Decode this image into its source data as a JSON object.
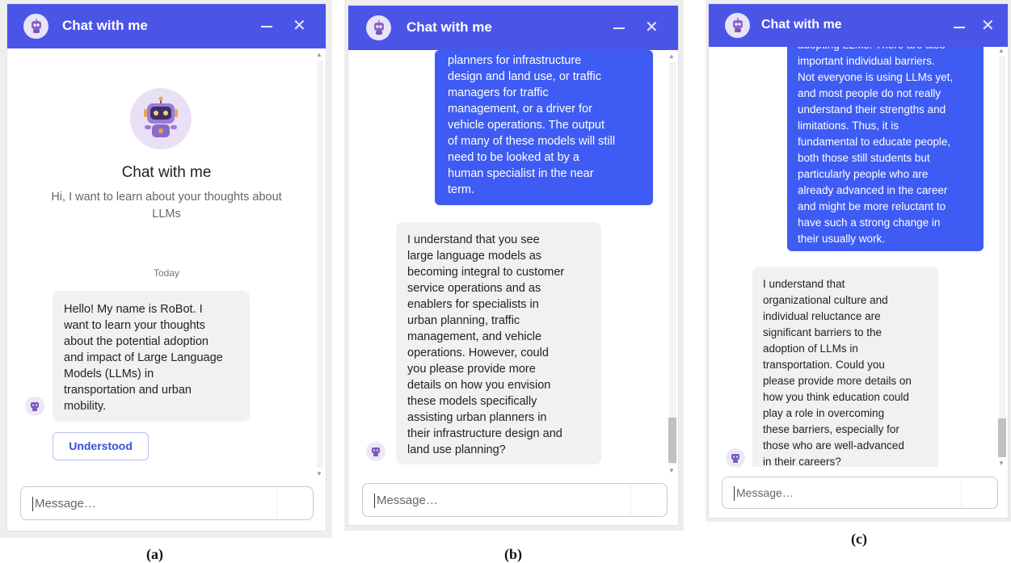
{
  "header": {
    "title": "Chat with me",
    "minimize_icon": "minimize-icon",
    "close_icon": "close-icon",
    "close_glyph": "✕"
  },
  "panel_a": {
    "welcome_title": "Chat with me",
    "welcome_subtitle_lines": [
      "Hi, I want to learn about your thoughts about",
      "LLMs"
    ],
    "date_divider": "Today",
    "bot_message_lines": [
      "Hello! My name is RoBot. I",
      "want to learn your thoughts",
      "about the potential adoption",
      "and impact of Large Language",
      "Models (LLMs) in",
      "transportation and urban",
      "mobility."
    ],
    "quick_reply": "Understood",
    "input_placeholder": "Message…"
  },
  "panel_b": {
    "user_message_lines": [
      "planners for infrastructure",
      "design and land use, or traffic",
      "managers for traffic",
      "management, or a driver for",
      "vehicle operations. The output",
      "of many of these models will still",
      "need to be looked at by a",
      "human specialist in the near",
      "term."
    ],
    "bot_message_lines": [
      "I understand that you see",
      "large language models as",
      "becoming integral to customer",
      "service operations and as",
      "enablers for specialists in",
      "urban planning, traffic",
      "management, and vehicle",
      "operations. However, could",
      "you please provide more",
      "details on how you envision",
      "these models specifically",
      "assisting urban planners in",
      "their infrastructure design and",
      "land use planning?"
    ],
    "input_placeholder": "Message…"
  },
  "panel_c": {
    "user_message_lines": [
      "adopting LLMs. There are also",
      "important individual barriers.",
      "Not everyone is using LLMs yet,",
      "and most people do not really",
      "understand their strengths and",
      "limitations. Thus, it is",
      "fundamental to educate people,",
      "both those still students but",
      "particularly people who are",
      "already advanced in the career",
      "and might be more reluctant to",
      "have such a strong change in",
      "their usually work."
    ],
    "bot_message_lines": [
      "I understand that",
      "organizational culture and",
      "individual reluctance are",
      "significant barriers to the",
      "adoption of LLMs in",
      "transportation. Could you",
      "please provide more details on",
      "how you think education could",
      "play a role in overcoming",
      "these barriers, especially for",
      "those who are well-advanced",
      "in their careers?"
    ],
    "input_placeholder": "Message…"
  },
  "captions": {
    "a": "(a)",
    "b": "(b)",
    "c": "(c)"
  },
  "colors": {
    "header": "#4a55e8",
    "user_bubble": "#3e5cf4",
    "bot_bubble": "#f1f1f1",
    "quick_reply_text": "#3b4fd8"
  }
}
